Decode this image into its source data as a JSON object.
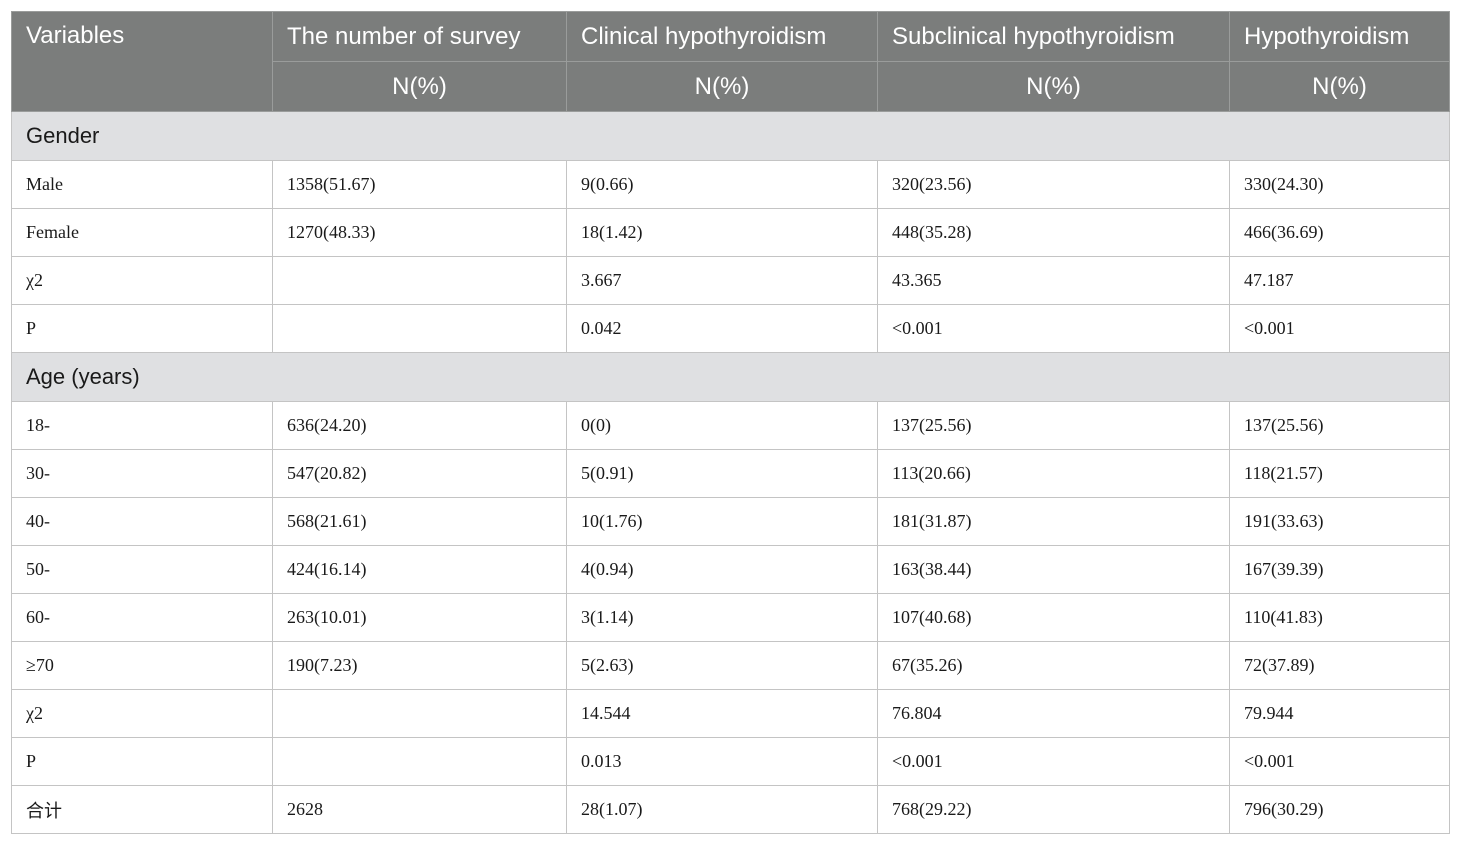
{
  "table": {
    "header": {
      "columns": [
        "Variables",
        "The number of survey",
        "Clinical hypothyroidism",
        "Subclinical hypothyroidism",
        "Hypothyroidism"
      ],
      "subheaders": [
        "N(%)",
        "N(%)",
        "N(%)",
        "N(%)"
      ]
    },
    "sections": [
      {
        "title": "Gender",
        "rows": [
          [
            "Male",
            "1358(51.67)",
            "9(0.66)",
            "320(23.56)",
            "330(24.30)"
          ],
          [
            "Female",
            "1270(48.33)",
            "18(1.42)",
            "448(35.28)",
            "466(36.69)"
          ],
          [
            "χ2",
            "",
            "3.667",
            "43.365",
            "47.187"
          ],
          [
            "P",
            "",
            "0.042",
            "<0.001",
            "<0.001"
          ]
        ]
      },
      {
        "title": "Age (years)",
        "rows": [
          [
            "18-",
            "636(24.20)",
            "0(0)",
            "137(25.56)",
            "137(25.56)"
          ],
          [
            "30-",
            "547(20.82)",
            "5(0.91)",
            "113(20.66)",
            "118(21.57)"
          ],
          [
            "40-",
            "568(21.61)",
            "10(1.76)",
            "181(31.87)",
            "191(33.63)"
          ],
          [
            "50-",
            "424(16.14)",
            "4(0.94)",
            "163(38.44)",
            "167(39.39)"
          ],
          [
            "60-",
            "263(10.01)",
            "3(1.14)",
            "107(40.68)",
            "110(41.83)"
          ],
          [
            "≥70",
            "190(7.23)",
            "5(2.63)",
            "67(35.26)",
            "72(37.89)"
          ],
          [
            "χ2",
            "",
            "14.544",
            "76.804",
            "79.944"
          ],
          [
            "P",
            "",
            "0.013",
            "<0.001",
            "<0.001"
          ]
        ]
      }
    ],
    "total_row": [
      "合计",
      "2628",
      "28(1.07)",
      "768(29.22)",
      "796(30.29)"
    ]
  },
  "colors": {
    "header_bg": "#7b7d7c",
    "header_text": "#ffffff",
    "section_bg": "#dfe0e2",
    "border": "#c4c4c4"
  }
}
